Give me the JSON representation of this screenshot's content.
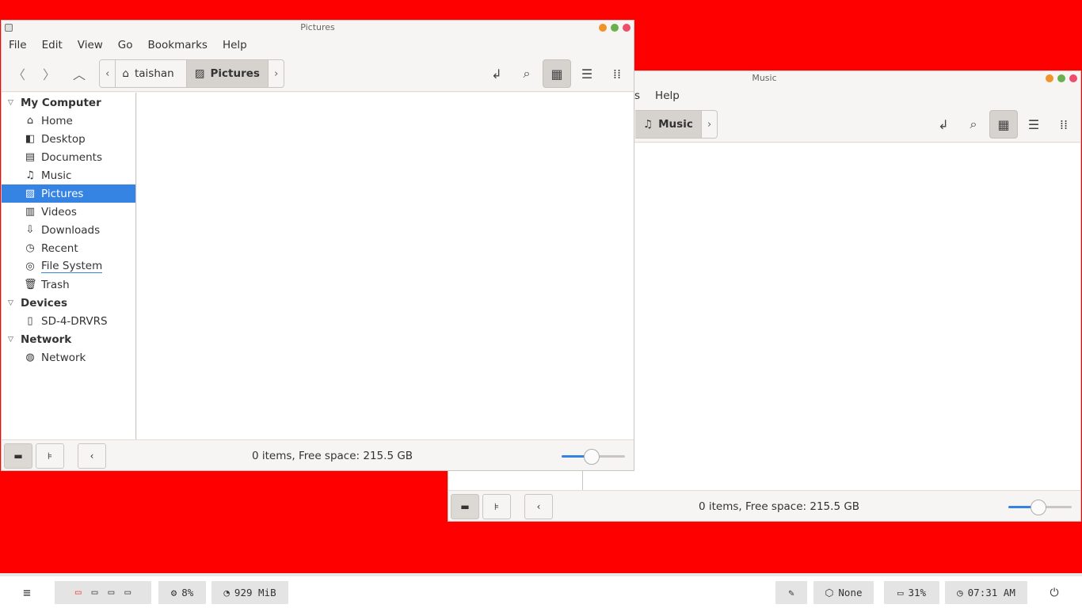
{
  "windows": {
    "pictures": {
      "title": "Pictures",
      "menu": [
        "File",
        "Edit",
        "View",
        "Go",
        "Bookmarks",
        "Help"
      ],
      "path": {
        "home": "taishan",
        "current": "Pictures"
      },
      "sidebar": {
        "sections": [
          {
            "label": "My Computer",
            "items": [
              "Home",
              "Desktop",
              "Documents",
              "Music",
              "Pictures",
              "Videos",
              "Downloads",
              "Recent",
              "File System",
              "Trash"
            ]
          },
          {
            "label": "Devices",
            "items": [
              "SD-4-DRVRS"
            ]
          },
          {
            "label": "Network",
            "items": [
              "Network"
            ]
          }
        ],
        "selected": "Pictures"
      },
      "status": "0 items, Free space: 215.5 GB",
      "zoom_level_percent": 50
    },
    "music": {
      "title": "Music",
      "menu_partial": [
        "s",
        "Help"
      ],
      "path": {
        "current": "Music"
      },
      "status": "0 items, Free space: 215.5 GB",
      "zoom_level_percent": 50
    }
  },
  "taskbar": {
    "cpu": "8%",
    "memory": "929 MiB",
    "network": "None",
    "battery": "31%",
    "clock": "07:31 AM"
  },
  "colors": {
    "desktop": "#ff0000",
    "accent": "#3584e4",
    "selection": "#3584e4"
  }
}
